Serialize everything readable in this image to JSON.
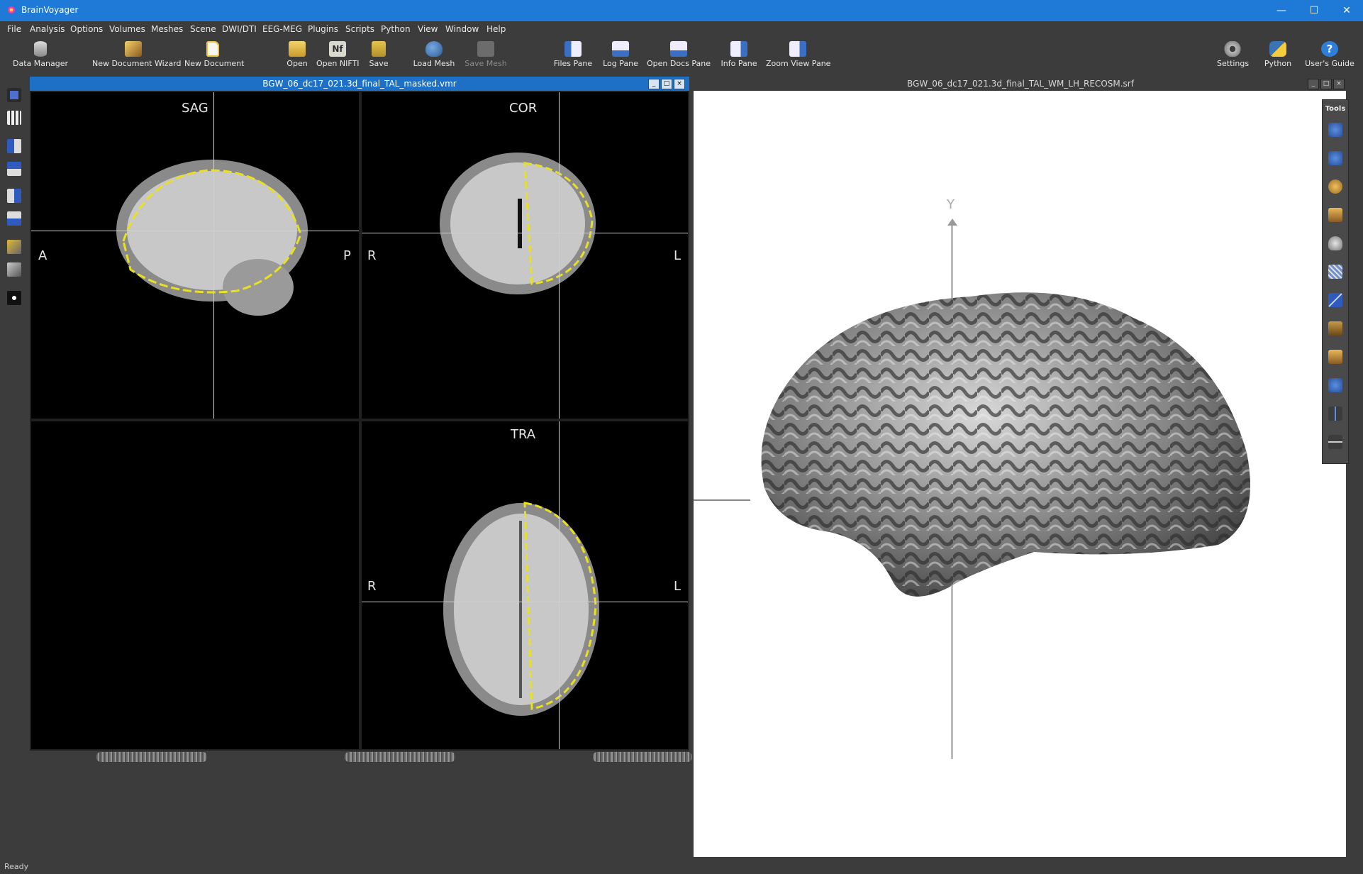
{
  "app": {
    "title": "BrainVoyager"
  },
  "window_controls": {
    "minimize": "—",
    "maximize": "☐",
    "close": "✕"
  },
  "menubar": [
    "File",
    "Analysis",
    "Options",
    "Volumes",
    "Meshes",
    "Scene",
    "DWI/DTI",
    "EEG-MEG",
    "Plugins",
    "Scripts",
    "Python",
    "View",
    "Window",
    "Help"
  ],
  "toolbar": {
    "data_manager": "Data Manager",
    "new_document_wizard": "New Document Wizard",
    "new_document": "New Document",
    "open": "Open",
    "open_nifti": "Open NIFTI",
    "save": "Save",
    "load_mesh": "Load Mesh",
    "save_mesh": "Save Mesh",
    "files_pane": "Files Pane",
    "log_pane": "Log Pane",
    "open_docs_pane": "Open Docs Pane",
    "info_pane": "Info Pane",
    "zoom_view_pane": "Zoom View Pane",
    "settings": "Settings",
    "python": "Python",
    "users_guide": "User's Guide"
  },
  "vmr_window": {
    "title": "BGW_06_dc17_021.3d_final_TAL_masked.vmr",
    "sag": {
      "label": "SAG",
      "left": "A",
      "right": "P"
    },
    "cor": {
      "label": "COR",
      "left": "R",
      "right": "L"
    },
    "tra": {
      "label": "TRA",
      "left": "R",
      "right": "L"
    }
  },
  "srf_window": {
    "title": "BGW_06_dc17_021.3d_final_TAL_WM_LH_RECOSM.srf",
    "axis_label": "Y"
  },
  "tools_palette": {
    "title": "Tools"
  },
  "status": {
    "text": "Ready"
  },
  "colors": {
    "accent": "#1e7ad6",
    "outline": "#e8e020",
    "background": "#3c3c3c"
  }
}
